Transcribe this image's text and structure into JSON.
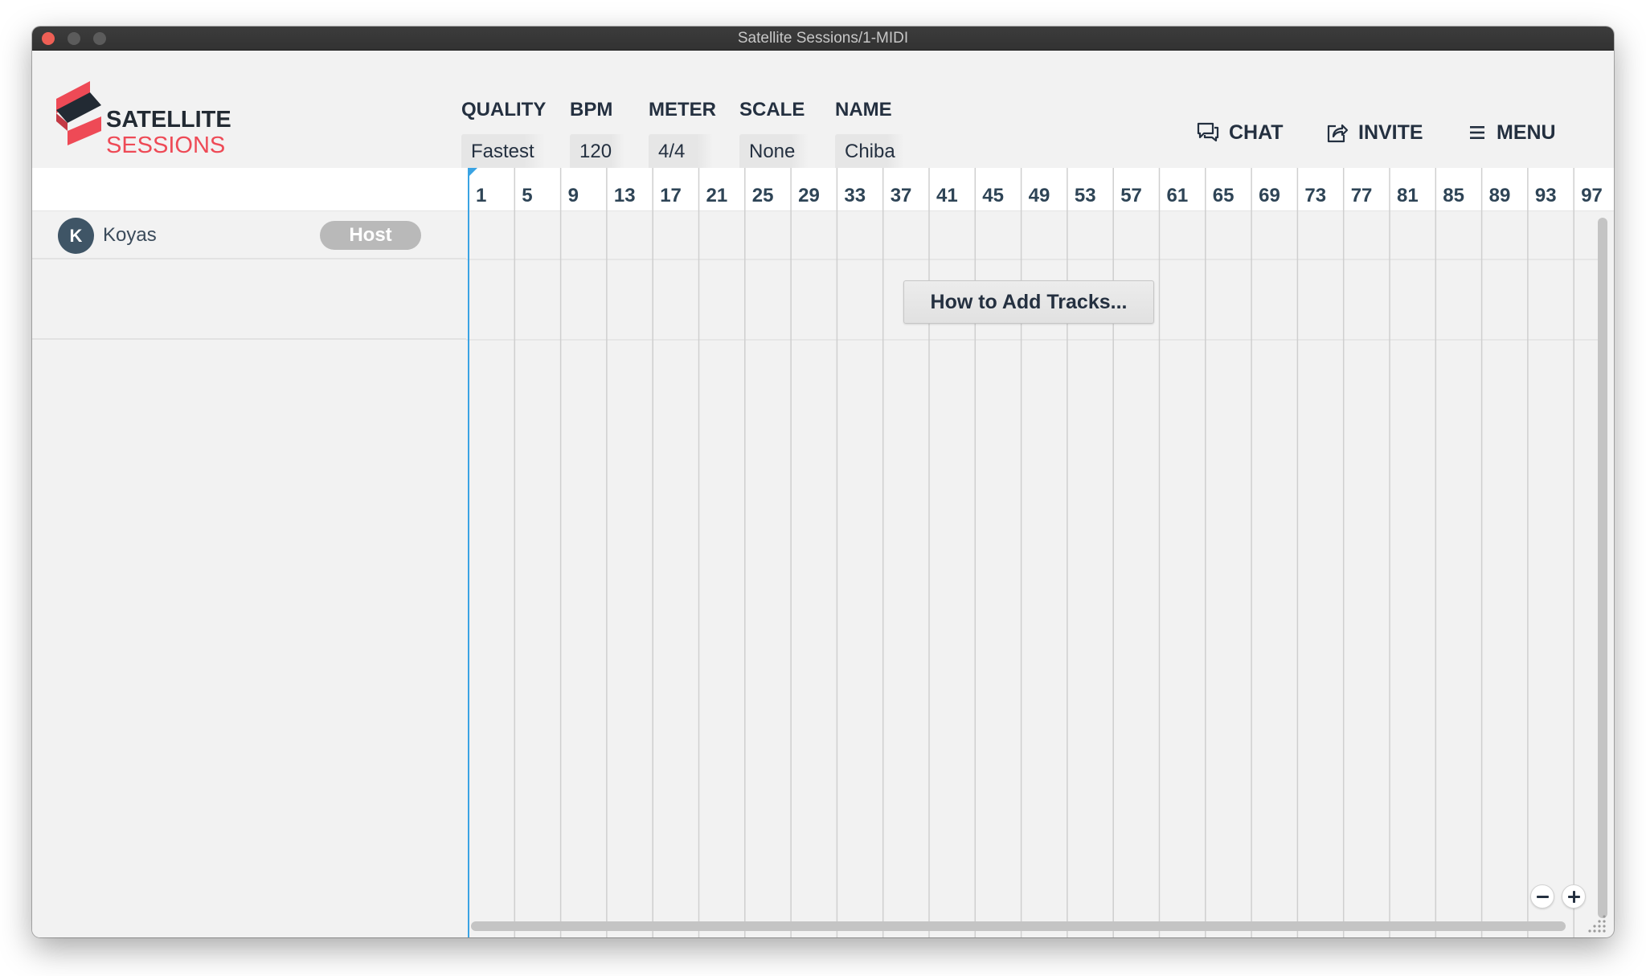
{
  "window": {
    "title": "Satellite Sessions/1-MIDI"
  },
  "logo": {
    "line1": "SATELLITE",
    "line2": "SESSIONS"
  },
  "settings": {
    "quality": {
      "label": "QUALITY",
      "value": "Fastest"
    },
    "bpm": {
      "label": "BPM",
      "value": "120"
    },
    "meter": {
      "label": "METER",
      "value": "4/4"
    },
    "scale": {
      "label": "SCALE",
      "value": "None"
    },
    "name": {
      "label": "NAME",
      "value": "Chiba"
    }
  },
  "actions": {
    "chat": "CHAT",
    "invite": "INVITE",
    "menu": "MENU"
  },
  "users": [
    {
      "initial": "K",
      "name": "Koyas",
      "role": "Host"
    }
  ],
  "timeline": {
    "bar_numbers": [
      "1",
      "5",
      "9",
      "13",
      "17",
      "21",
      "25",
      "29",
      "33",
      "37",
      "41",
      "45",
      "49",
      "53",
      "57",
      "61",
      "65",
      "69",
      "73",
      "77",
      "81",
      "85",
      "89",
      "93",
      "97"
    ],
    "add_tracks_button": "How to Add Tracks..."
  },
  "colors": {
    "accent": "#ee4a56",
    "playhead": "#3aa3e3",
    "text": "#243040"
  },
  "icons": {
    "chat": "chat-icon",
    "invite": "share-icon",
    "menu": "hamburger-icon",
    "zoom_out": "minus-icon",
    "zoom_in": "plus-icon"
  }
}
